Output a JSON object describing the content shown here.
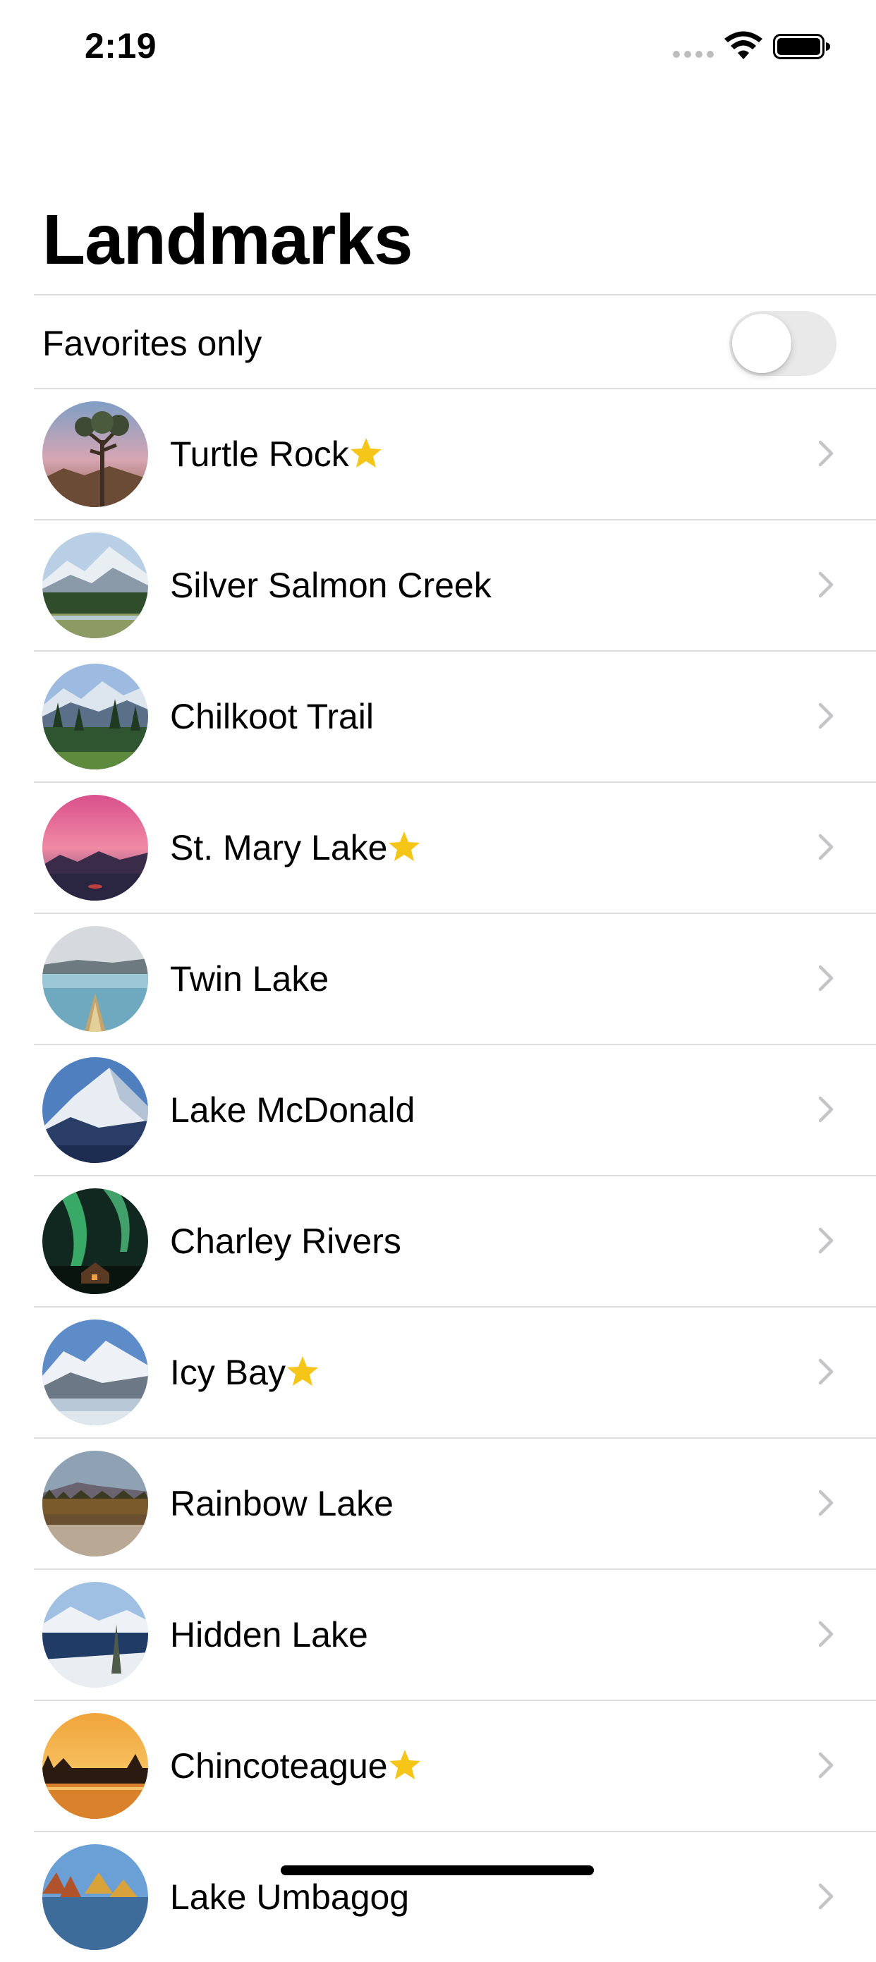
{
  "status_bar": {
    "time": "2:19",
    "icons": [
      "signal-icon",
      "wifi-icon",
      "battery-icon"
    ]
  },
  "title": "Landmarks",
  "filter": {
    "label": "Favorites only",
    "enabled": false
  },
  "accent_colors": {
    "star": "#F5C518",
    "chevron": "#C4C4C7",
    "separator": "#DEDEDE",
    "toggle_off": "#E9E9EA"
  },
  "landmarks": [
    {
      "name": "Turtle Rock",
      "favorite": true
    },
    {
      "name": "Silver Salmon Creek",
      "favorite": false
    },
    {
      "name": "Chilkoot Trail",
      "favorite": false
    },
    {
      "name": "St. Mary Lake",
      "favorite": true
    },
    {
      "name": "Twin Lake",
      "favorite": false
    },
    {
      "name": "Lake McDonald",
      "favorite": false
    },
    {
      "name": "Charley Rivers",
      "favorite": false
    },
    {
      "name": "Icy Bay",
      "favorite": true
    },
    {
      "name": "Rainbow Lake",
      "favorite": false
    },
    {
      "name": "Hidden Lake",
      "favorite": false
    },
    {
      "name": "Chincoteague",
      "favorite": true
    },
    {
      "name": "Lake Umbagog",
      "favorite": false
    }
  ]
}
